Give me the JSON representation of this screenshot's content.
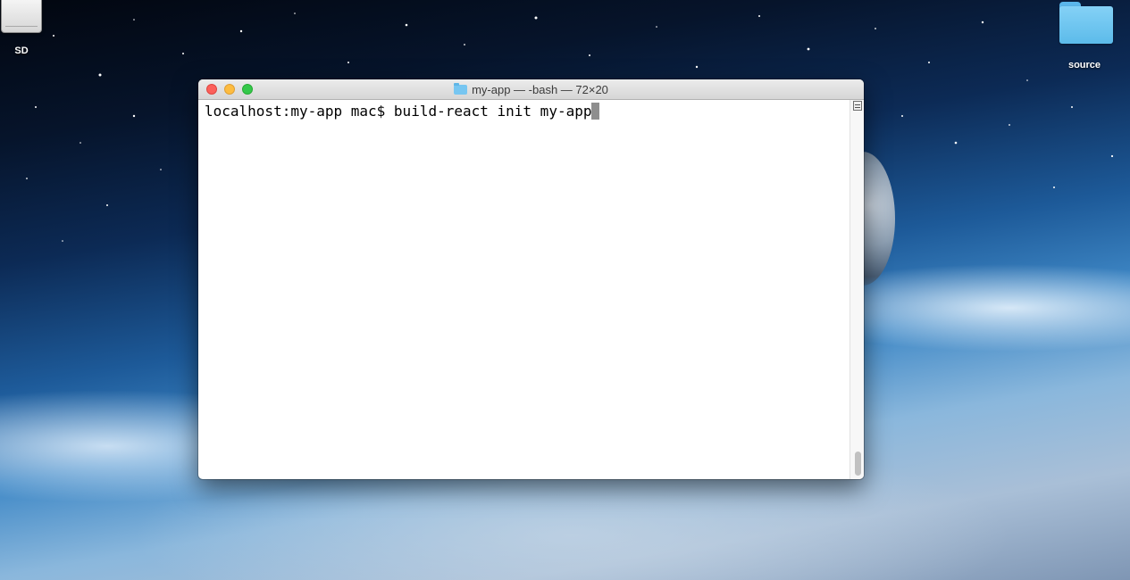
{
  "desktop": {
    "icons": [
      {
        "label": "SD",
        "icon": "sd-card-drive-icon"
      },
      {
        "label": "source",
        "icon": "folder-icon"
      }
    ]
  },
  "terminal": {
    "title": "my-app — -bash — 72×20",
    "title_icon": "folder-icon",
    "prompt": "localhost:my-app mac$ ",
    "command": "build-react init my-app"
  },
  "colors": {
    "close": "#fc605b",
    "minimize": "#fdbc40",
    "zoom": "#34c84a",
    "folder": "#5cbbea"
  }
}
